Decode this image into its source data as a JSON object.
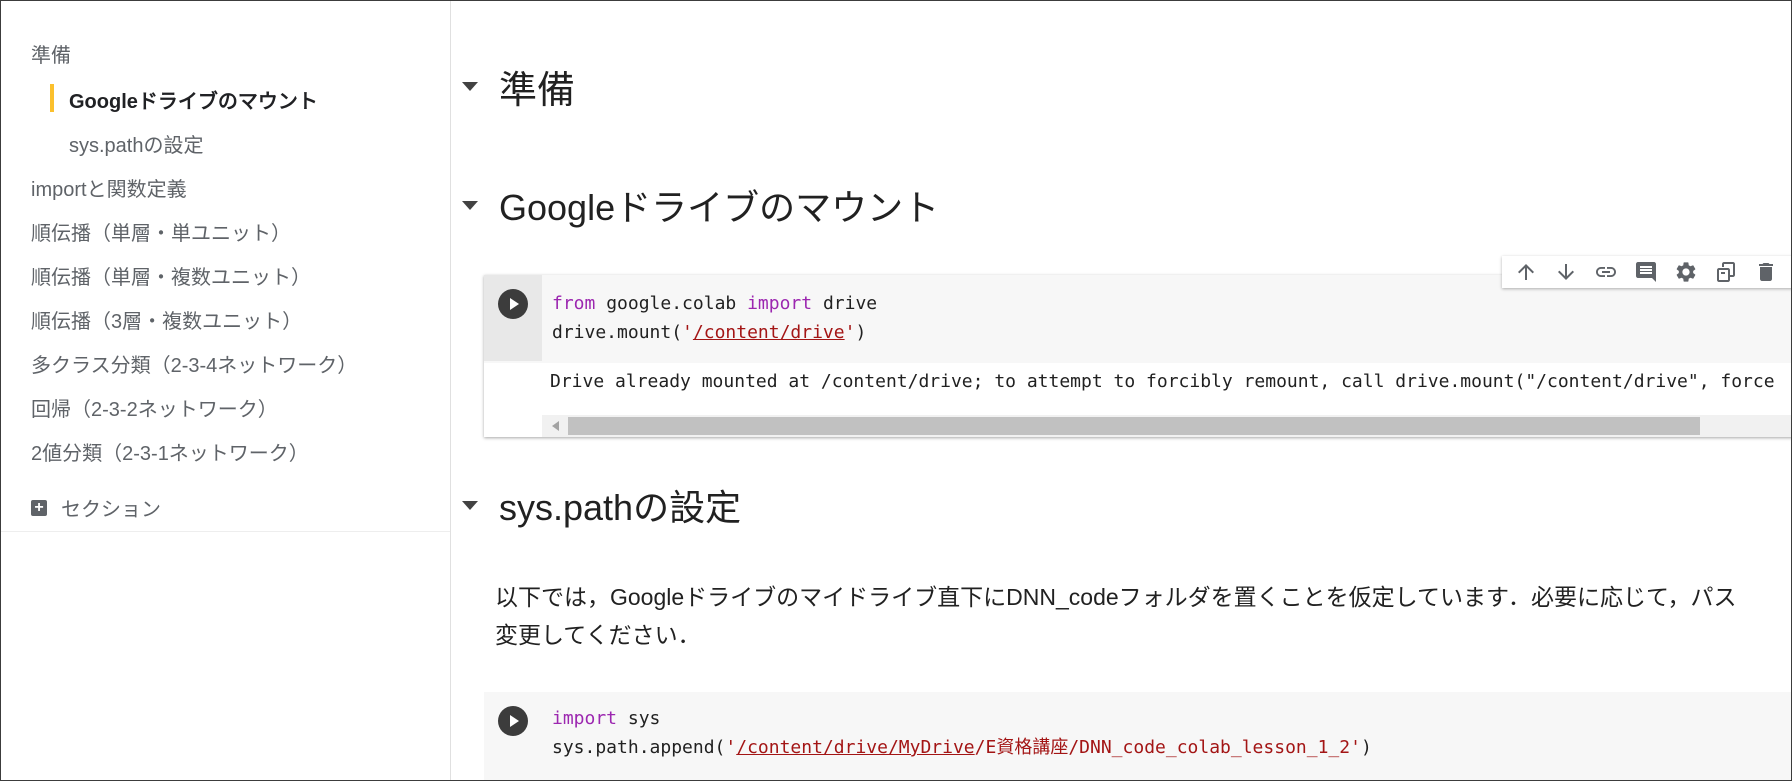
{
  "toc": {
    "items": [
      {
        "label": "準備"
      },
      {
        "label": "Googleドライブのマウント"
      },
      {
        "label": "sys.pathの設定"
      },
      {
        "label": "importと関数定義"
      },
      {
        "label": "順伝播（単層・単ユニット）"
      },
      {
        "label": "順伝播（単層・複数ユニット）"
      },
      {
        "label": "順伝播（3層・複数ユニット）"
      },
      {
        "label": "多クラス分類（2-3-4ネットワーク）"
      },
      {
        "label": "回帰（2-3-2ネットワーク）"
      },
      {
        "label": "2値分類（2-3-1ネットワーク）"
      }
    ],
    "active_index": 1,
    "add_section_label": "セクション",
    "accent_color": "#fbc02d"
  },
  "notebook": {
    "heading1": "準備",
    "heading2": "Googleドライブのマウント",
    "cell1": {
      "kw_from": "from",
      "module": " google.colab ",
      "kw_import": "import",
      "name": " drive",
      "call": "drive.mount(",
      "str_open": "'",
      "path": "/content/drive",
      "str_close": "'",
      "paren": ")",
      "output": "Drive already mounted at /content/drive; to attempt to forcibly remount, call drive.mount(\"/content/drive\", force"
    },
    "toolbar": [
      "arrow-up-icon",
      "arrow-down-icon",
      "link-icon",
      "comment-icon",
      "gear-icon",
      "mirror-cell-icon",
      "trash-icon"
    ],
    "heading3": "sys.pathの設定",
    "text_line1": "以下では，Googleドライブのマイドライブ直下にDNN_codeフォルダを置くことを仮定しています．必要に応じて，パス",
    "text_line2": "変更してください．",
    "cell2": {
      "kw_import": "import",
      "name": " sys",
      "call": "sys.path.append(",
      "str_open": "'",
      "path_link": "/content/drive/MyDrive",
      "path_rest": "/E資格講座/DNN_code_colab_lesson_1_2",
      "str_close": "'",
      "paren": ")"
    }
  }
}
